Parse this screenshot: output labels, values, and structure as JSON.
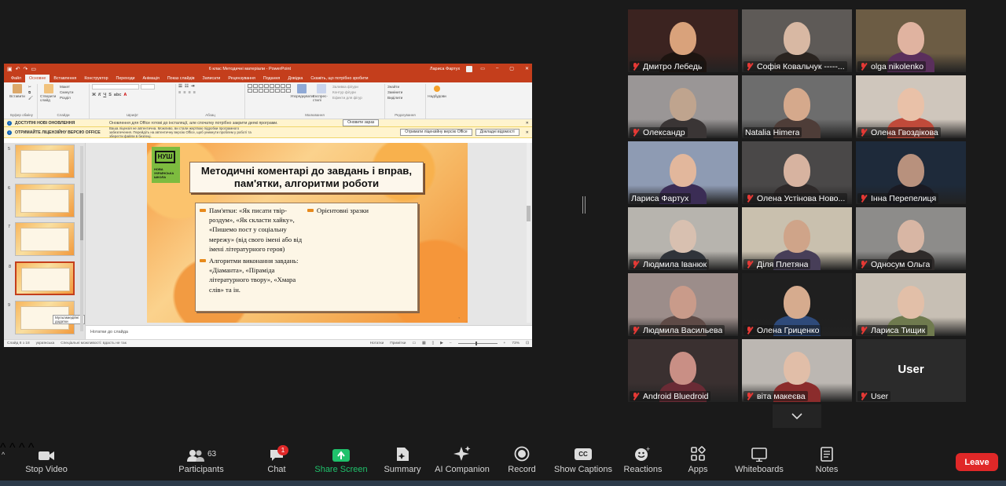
{
  "ppt": {
    "doc_title": "6 клас Методичні матеріали  -  PowerPoint",
    "user_name": "Лариса Фартух",
    "tabs": [
      "Файл",
      "Основне",
      "Вставлення",
      "Конструктор",
      "Переходи",
      "Анімація",
      "Показ слайдів",
      "Записати",
      "Рецензування",
      "Подання",
      "Довідка"
    ],
    "tell_me": "Скажіть, що потрібно зробити",
    "ribbon": {
      "paste": "Вставити",
      "clipboard_group": "Буфер обміну",
      "new_slide": "Створити слайд",
      "layout": "Макет",
      "reset": "Скинути",
      "section": "Розділ",
      "slides_group": "Слайди",
      "font_group": "Шрифт",
      "paragraph_group": "Абзац",
      "arrange": "Упорядкувати",
      "quick_styles": "Експрес-стилі",
      "fill": "Заливка фігури",
      "outline": "Контур фігури",
      "effects": "Ефекти для фігур",
      "drawing_group": "Малювання",
      "find": "Знайти",
      "replace": "Замінити",
      "select": "Виділити",
      "editing_group": "Редагування",
      "designer": "Надбудови"
    },
    "banners": [
      {
        "title": "ДОСТУПНІ НОВІ ОНОВЛЕННЯ",
        "message": "Оновлення для Office готові до інсталяції, але спочатку потрібно закрити деякі програми.",
        "button": "Оновити зараз",
        "button2": ""
      },
      {
        "title": "ОТРИМАЙТЕ ЛІЦЕНЗІЙНУ ВЕРСІЮ OFFICE",
        "message": "Ваша ліцензія не автентична. Можливо, ви стали жертвою підробки програмного забезпечення. Перейдіть на автентичну версію Office, щоб уникнути проблем у роботі та зберегти файли в безпеці.",
        "button": "Отримати ліцензійну версію Office",
        "button2": "Докладні відомості"
      }
    ],
    "thumbnails": [
      {
        "num": "5",
        "selected": false
      },
      {
        "num": "6",
        "selected": false
      },
      {
        "num": "7",
        "selected": false
      },
      {
        "num": "8",
        "selected": true
      },
      {
        "num": "9",
        "selected": false
      }
    ],
    "thumb_tooltip": "Мультимедійні додатки",
    "slide": {
      "logo_text": "НУШ",
      "logo_sub": "НОВА УКРАЇНСЬКА ШКОЛА",
      "title": "Методичні коментарі до завдань і вправ, пам'ятки, алгоритми роботи",
      "col1_bullets": [
        "Пам'ятки: «Як писати твір-роздум», «Як скласти хайку», «Пишемо пост у соціальну мережу» (від свого імені або від імені літературного героя)",
        "Алгоритми виконання завдань: «Діаманта», «Піраміда літературного твору», «Хмара слів» та ін."
      ],
      "col2_bullets": [
        "Орієнтовні зразки"
      ]
    },
    "notes_placeholder": "Нотатки до слайда",
    "status": {
      "slide_of": "Слайд 8 з 18",
      "language": "українська",
      "accessibility": "Спеціальні можливості: вдасть не так",
      "notes": "Нотатки",
      "comments": "Примітки",
      "zoom": "73%"
    }
  },
  "participants": [
    {
      "name": "Дмитро Лебедь",
      "muted": true,
      "active": false
    },
    {
      "name": "Софія Ковальчук -----...",
      "muted": true,
      "active": false
    },
    {
      "name": "olga nikolenko",
      "muted": true,
      "active": false
    },
    {
      "name": "Олександр",
      "muted": true,
      "active": false
    },
    {
      "name": "Natalia Himera",
      "muted": false,
      "active": false
    },
    {
      "name": "Олена Гвоздікова",
      "muted": true,
      "active": false
    },
    {
      "name": "Лариса Фартух",
      "muted": false,
      "active": true
    },
    {
      "name": "Олена Устінова Ново...",
      "muted": true,
      "active": false
    },
    {
      "name": "Інна Перепелиця",
      "muted": true,
      "active": false
    },
    {
      "name": "Людмила Іванюк",
      "muted": true,
      "active": false
    },
    {
      "name": "Діля Плетяна",
      "muted": true,
      "active": false
    },
    {
      "name": "Односум Ольга",
      "muted": true,
      "active": false
    },
    {
      "name": "Людмила Васильева",
      "muted": true,
      "active": false
    },
    {
      "name": "Олена Гриценко",
      "muted": true,
      "active": false
    },
    {
      "name": "Лариса Тищик",
      "muted": true,
      "active": false
    },
    {
      "name": "Android Bluedroid",
      "muted": true,
      "active": false
    },
    {
      "name": "віта макеєва",
      "muted": true,
      "active": false
    },
    {
      "name": "User",
      "muted": true,
      "active": false,
      "video_off_label": "User"
    }
  ],
  "toolbar": {
    "stop_video": "Stop Video",
    "participants": "Participants",
    "participants_count": "63",
    "chat": "Chat",
    "chat_badge": "1",
    "share_screen": "Share Screen",
    "summary": "Summary",
    "ai_companion": "AI Companion",
    "record": "Record",
    "show_captions": "Show Captions",
    "captions_icon_text": "CC",
    "reactions": "Reactions",
    "apps": "Apps",
    "whiteboards": "Whiteboards",
    "notes": "Notes",
    "leave": "Leave"
  },
  "colors": {
    "ppt_accent": "#c43e1c",
    "share_green": "#1fc16b",
    "leave_red": "#e02828",
    "active_speaker": "#c4dd4c",
    "muted_red": "#e53935"
  }
}
